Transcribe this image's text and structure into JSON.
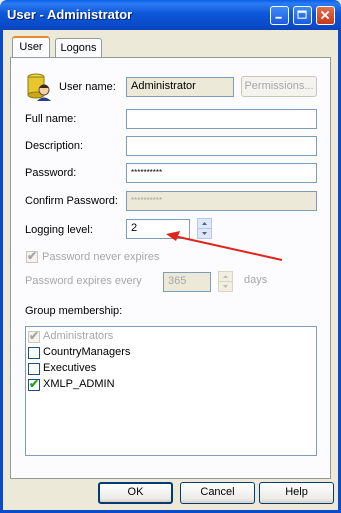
{
  "window": {
    "title": "User - Administrator"
  },
  "tabs": [
    {
      "label": "User",
      "active": true
    },
    {
      "label": "Logons",
      "active": false
    }
  ],
  "form": {
    "user_name_label": "User name:",
    "user_name_value": "Administrator",
    "permissions_label": "Permissions...",
    "full_name_label": "Full name:",
    "full_name_value": "",
    "description_label": "Description:",
    "description_value": "",
    "password_label": "Password:",
    "password_value": "**********",
    "confirm_password_label": "Confirm Password:",
    "confirm_password_value": "**********",
    "logging_level_label": "Logging level:",
    "logging_level_value": "2",
    "password_never_expires_label": "Password never expires",
    "password_never_expires_checked": true,
    "password_expires_every_label": "Password expires every",
    "password_expires_every_value": "365",
    "days_label": "days",
    "group_membership_label": "Group membership:"
  },
  "groups": [
    {
      "label": "Administrators",
      "checked": true,
      "disabled": true
    },
    {
      "label": "CountryManagers",
      "checked": false,
      "disabled": false
    },
    {
      "label": "Executives",
      "checked": false,
      "disabled": false
    },
    {
      "label": "XMLP_ADMIN",
      "checked": true,
      "disabled": false
    }
  ],
  "buttons": {
    "ok": "OK",
    "cancel": "Cancel",
    "help": "Help"
  },
  "colors": {
    "title_bar": "#0A4BC9",
    "annotation_arrow": "#E0241B"
  },
  "icons": {
    "user": "user-avatar-icon",
    "minimize": "minimize-icon",
    "maximize": "maximize-icon",
    "close": "close-icon"
  }
}
